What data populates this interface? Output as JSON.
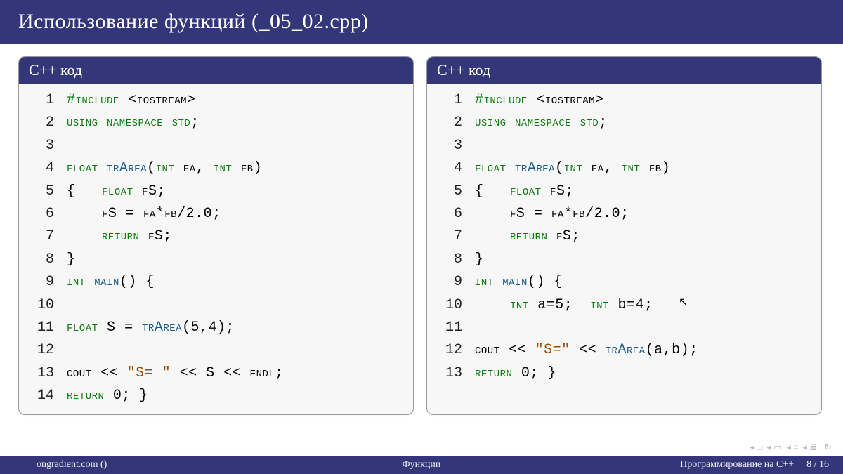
{
  "header": {
    "title": "Использование функций (_05_02.cpp)"
  },
  "left_panel": {
    "title": "С++ код",
    "lines": [
      {
        "n": "1",
        "code": [
          {
            "t": "#include",
            "c": "kw"
          },
          {
            "t": " <",
            "c": ""
          },
          {
            "t": "iostream",
            "c": "sc"
          },
          {
            "t": ">",
            "c": ""
          }
        ]
      },
      {
        "n": "2",
        "code": [
          {
            "t": "using namespace std",
            "c": "kw"
          },
          {
            "t": ";",
            "c": ""
          }
        ]
      },
      {
        "n": "3",
        "code": []
      },
      {
        "n": "4",
        "code": [
          {
            "t": "float",
            "c": "ty"
          },
          {
            "t": " ",
            "c": ""
          },
          {
            "t": "trArea",
            "c": "fn"
          },
          {
            "t": "(",
            "c": ""
          },
          {
            "t": "int",
            "c": "ty"
          },
          {
            "t": " ",
            "c": ""
          },
          {
            "t": "fa",
            "c": "sc"
          },
          {
            "t": ", ",
            "c": ""
          },
          {
            "t": "int",
            "c": "ty"
          },
          {
            "t": " ",
            "c": ""
          },
          {
            "t": "fb",
            "c": "sc"
          },
          {
            "t": ")",
            "c": ""
          }
        ]
      },
      {
        "n": "5",
        "code": [
          {
            "t": "{   ",
            "c": ""
          },
          {
            "t": "float",
            "c": "ty"
          },
          {
            "t": " ",
            "c": ""
          },
          {
            "t": "fS",
            "c": "sc"
          },
          {
            "t": ";",
            "c": ""
          }
        ]
      },
      {
        "n": "6",
        "code": [
          {
            "t": "    ",
            "c": ""
          },
          {
            "t": "fS",
            "c": "sc"
          },
          {
            "t": " = ",
            "c": ""
          },
          {
            "t": "fa",
            "c": "sc"
          },
          {
            "t": "*",
            "c": ""
          },
          {
            "t": "fb",
            "c": "sc"
          },
          {
            "t": "/2.0;",
            "c": ""
          }
        ]
      },
      {
        "n": "7",
        "code": [
          {
            "t": "    ",
            "c": ""
          },
          {
            "t": "return",
            "c": "kw"
          },
          {
            "t": " ",
            "c": ""
          },
          {
            "t": "fS",
            "c": "sc"
          },
          {
            "t": ";",
            "c": ""
          }
        ]
      },
      {
        "n": "8",
        "code": [
          {
            "t": "}",
            "c": ""
          }
        ]
      },
      {
        "n": "9",
        "code": [
          {
            "t": "int",
            "c": "ty"
          },
          {
            "t": " ",
            "c": ""
          },
          {
            "t": "main",
            "c": "fn"
          },
          {
            "t": "() {",
            "c": ""
          }
        ]
      },
      {
        "n": "10",
        "code": []
      },
      {
        "n": "11",
        "code": [
          {
            "t": "float",
            "c": "ty"
          },
          {
            "t": " S = ",
            "c": ""
          },
          {
            "t": "trArea",
            "c": "fn"
          },
          {
            "t": "(5,4);",
            "c": ""
          }
        ]
      },
      {
        "n": "12",
        "code": []
      },
      {
        "n": "13",
        "code": [
          {
            "t": "cout",
            "c": "sc"
          },
          {
            "t": " << ",
            "c": ""
          },
          {
            "t": "\"S= \"",
            "c": "str"
          },
          {
            "t": " << S << ",
            "c": ""
          },
          {
            "t": "endl",
            "c": "sc"
          },
          {
            "t": ";",
            "c": ""
          }
        ]
      },
      {
        "n": "14",
        "code": [
          {
            "t": "return",
            "c": "kw"
          },
          {
            "t": " 0; }",
            "c": ""
          }
        ]
      }
    ]
  },
  "right_panel": {
    "title": "С++ код",
    "lines": [
      {
        "n": "1",
        "code": [
          {
            "t": "#include",
            "c": "kw"
          },
          {
            "t": " <",
            "c": ""
          },
          {
            "t": "iostream",
            "c": "sc"
          },
          {
            "t": ">",
            "c": ""
          }
        ]
      },
      {
        "n": "2",
        "code": [
          {
            "t": "using namespace std",
            "c": "kw"
          },
          {
            "t": ";",
            "c": ""
          }
        ]
      },
      {
        "n": "3",
        "code": []
      },
      {
        "n": "4",
        "code": [
          {
            "t": "float",
            "c": "ty"
          },
          {
            "t": " ",
            "c": ""
          },
          {
            "t": "trArea",
            "c": "fn"
          },
          {
            "t": "(",
            "c": ""
          },
          {
            "t": "int",
            "c": "ty"
          },
          {
            "t": " ",
            "c": ""
          },
          {
            "t": "fa",
            "c": "sc"
          },
          {
            "t": ", ",
            "c": ""
          },
          {
            "t": "int",
            "c": "ty"
          },
          {
            "t": " ",
            "c": ""
          },
          {
            "t": "fb",
            "c": "sc"
          },
          {
            "t": ")",
            "c": ""
          }
        ]
      },
      {
        "n": "5",
        "code": [
          {
            "t": "{   ",
            "c": ""
          },
          {
            "t": "float",
            "c": "ty"
          },
          {
            "t": " ",
            "c": ""
          },
          {
            "t": "fS",
            "c": "sc"
          },
          {
            "t": ";",
            "c": ""
          }
        ]
      },
      {
        "n": "6",
        "code": [
          {
            "t": "    ",
            "c": ""
          },
          {
            "t": "fS",
            "c": "sc"
          },
          {
            "t": " = ",
            "c": ""
          },
          {
            "t": "fa",
            "c": "sc"
          },
          {
            "t": "*",
            "c": ""
          },
          {
            "t": "fb",
            "c": "sc"
          },
          {
            "t": "/2.0;",
            "c": ""
          }
        ]
      },
      {
        "n": "7",
        "code": [
          {
            "t": "    ",
            "c": ""
          },
          {
            "t": "return",
            "c": "kw"
          },
          {
            "t": " ",
            "c": ""
          },
          {
            "t": "fS",
            "c": "sc"
          },
          {
            "t": ";",
            "c": ""
          }
        ]
      },
      {
        "n": "8",
        "code": [
          {
            "t": "}",
            "c": ""
          }
        ]
      },
      {
        "n": "9",
        "code": [
          {
            "t": "int",
            "c": "ty"
          },
          {
            "t": " ",
            "c": ""
          },
          {
            "t": "main",
            "c": "fn"
          },
          {
            "t": "() {",
            "c": ""
          }
        ]
      },
      {
        "n": "10",
        "code": [
          {
            "t": "    ",
            "c": ""
          },
          {
            "t": "int",
            "c": "ty"
          },
          {
            "t": " a=5;  ",
            "c": ""
          },
          {
            "t": "int",
            "c": "ty"
          },
          {
            "t": " b=4;",
            "c": ""
          }
        ]
      },
      {
        "n": "11",
        "code": []
      },
      {
        "n": "12",
        "code": [
          {
            "t": "cout",
            "c": "sc"
          },
          {
            "t": " << ",
            "c": ""
          },
          {
            "t": "\"S=\"",
            "c": "str"
          },
          {
            "t": " << ",
            "c": ""
          },
          {
            "t": "trArea",
            "c": "fn"
          },
          {
            "t": "(a,b);",
            "c": ""
          }
        ]
      },
      {
        "n": "13",
        "code": [
          {
            "t": "return",
            "c": "kw"
          },
          {
            "t": " 0; }",
            "c": ""
          }
        ]
      }
    ]
  },
  "footer": {
    "site": "ongradient.com ()",
    "center": "Функции",
    "right": "Программирование на С++",
    "page": "8 / 16"
  }
}
